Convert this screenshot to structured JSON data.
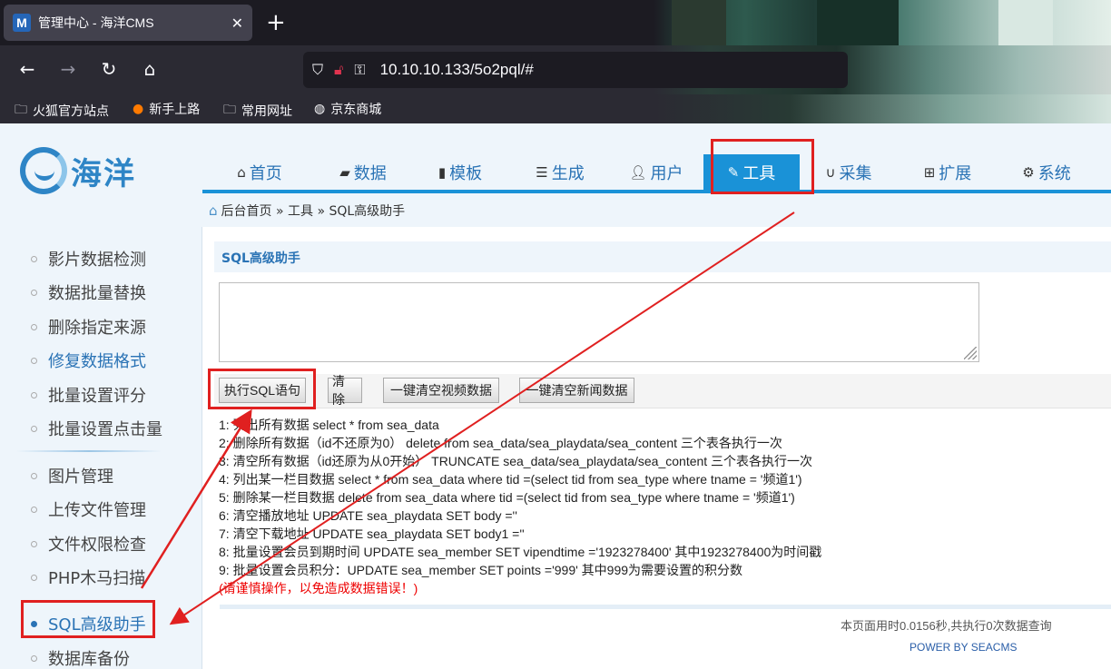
{
  "browser": {
    "tab_title": "管理中心 - 海洋CMS",
    "tab_favicon": "M",
    "url": "10.10.10.133/5o2pql/#",
    "bookmarks": [
      "火狐官方站点",
      "新手上路",
      "常用网址",
      "京东商城"
    ]
  },
  "logo": {
    "text": "海洋"
  },
  "mainnav": [
    {
      "label": "首页",
      "icon": "home-icon"
    },
    {
      "label": "数据",
      "icon": "book-icon"
    },
    {
      "label": "模板",
      "icon": "file-icon"
    },
    {
      "label": "生成",
      "icon": "server-icon"
    },
    {
      "label": "用户",
      "icon": "user-icon"
    },
    {
      "label": "工具",
      "icon": "edit-icon",
      "active": true
    },
    {
      "label": "采集",
      "icon": "magnet-icon"
    },
    {
      "label": "扩展",
      "icon": "sitemap-icon"
    },
    {
      "label": "系统",
      "icon": "gear-icon"
    }
  ],
  "breadcrumb": "后台首页 » 工具 » SQL高级助手",
  "sidebar": [
    "影片数据检测",
    "数据批量替换",
    "删除指定来源",
    "修复数据格式",
    "批量设置评分",
    "批量设置点击量",
    "图片管理",
    "上传文件管理",
    "文件权限检查",
    "PHP木马扫描",
    "SQL高级助手",
    "数据库备份"
  ],
  "panel": {
    "title": "SQL高级助手",
    "buttons": [
      "执行SQL语句",
      "清 除",
      "一键清空视频数据",
      "一键清空新闻数据"
    ],
    "tips": [
      "1: 列出所有数据 select * from sea_data",
      "2: 删除所有数据（id不还原为0） delete from sea_data/sea_playdata/sea_content 三个表各执行一次",
      "3: 清空所有数据（id还原为从0开始） TRUNCATE sea_data/sea_playdata/sea_content 三个表各执行一次",
      "4: 列出某一栏目数据 select * from sea_data where tid =(select tid from sea_type where tname = '频道1')",
      "5: 删除某一栏目数据 delete from sea_data where tid =(select tid from sea_type where tname = '频道1')",
      "6: 清空播放地址 UPDATE sea_playdata SET body =''",
      "7: 清空下载地址 UPDATE sea_playdata SET body1 =''",
      "8: 批量设置会员到期时间 UPDATE sea_member SET vipendtime ='1923278400' 其中1923278400为时间戳",
      "9: 批量设置会员积分：UPDATE sea_member SET points ='999' 其中999为需要设置的积分数"
    ],
    "warning": "(请谨慎操作，以免造成数据错误！)"
  },
  "footer": {
    "stat": "本页面用时0.0156秒,共执行0次数据查询",
    "power": "POWER BY SEACMS"
  }
}
